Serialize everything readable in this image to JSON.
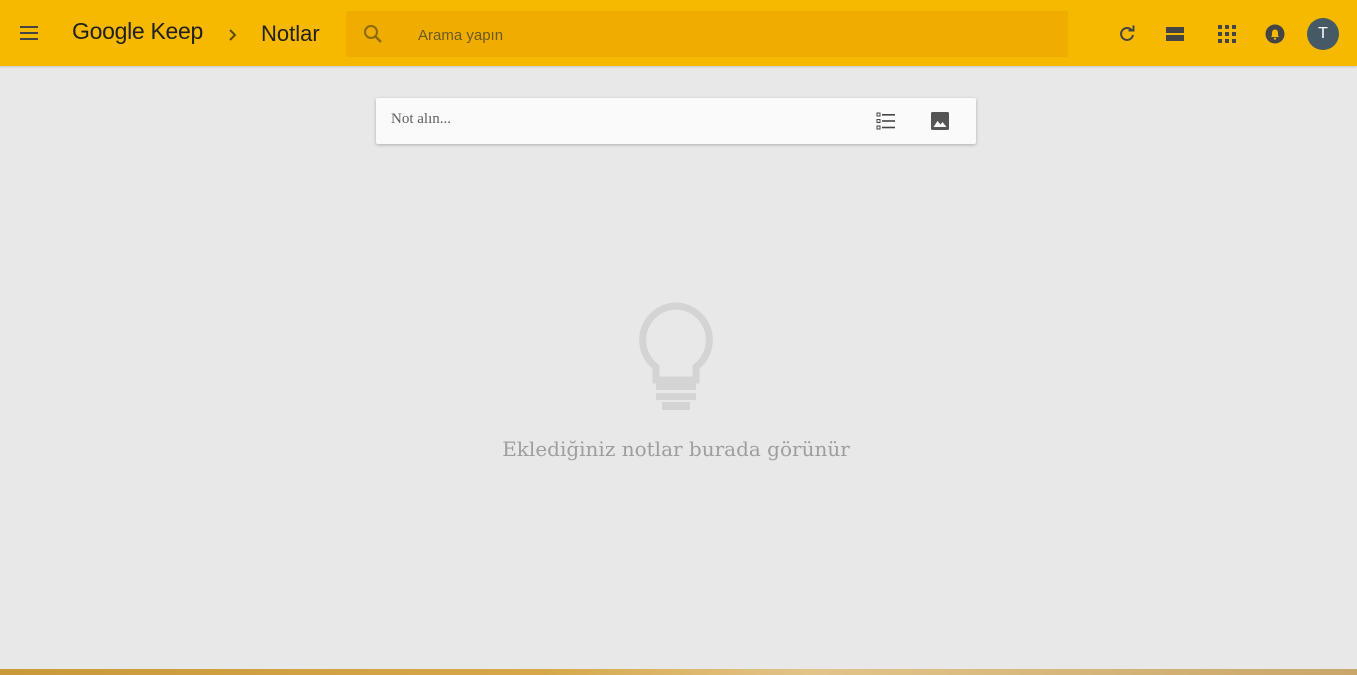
{
  "header": {
    "brand": "Google Keep",
    "section_title": "Notlar",
    "search_placeholder": "Arama yapın",
    "avatar_initial": "T",
    "colors": {
      "accent": "#f7b800",
      "search_bg": "#f0ad00",
      "avatar_bg": "#455a64"
    },
    "icons": [
      "menu-icon",
      "chevron-right-icon",
      "search-icon",
      "refresh-icon",
      "list-view-icon",
      "apps-grid-icon",
      "notifications-icon"
    ]
  },
  "composer": {
    "placeholder": "Not alın...",
    "icons": [
      "checklist-icon",
      "image-icon"
    ]
  },
  "empty_state": {
    "icon": "lightbulb-icon",
    "message": "Eklediğiniz notlar burada görünür"
  }
}
